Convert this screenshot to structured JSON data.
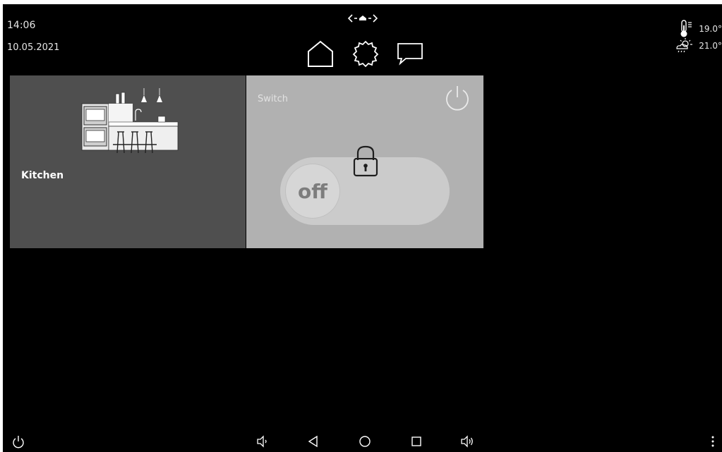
{
  "status": {
    "time": "14:06",
    "date": "10.05.2021"
  },
  "weather": {
    "indoor_temp": "19.0°",
    "outdoor_temp": "21.0°"
  },
  "nav": {
    "items": [
      {
        "name": "home-icon"
      },
      {
        "name": "settings-gear-icon"
      },
      {
        "name": "messages-icon"
      }
    ]
  },
  "tiles": {
    "kitchen": {
      "label": "Kitchen"
    },
    "switch": {
      "label": "Switch",
      "state": "off"
    }
  },
  "colors": {
    "background": "#000000",
    "kitchen_tile": "#4f4f4f",
    "switch_tile": "#b1b1b1"
  }
}
